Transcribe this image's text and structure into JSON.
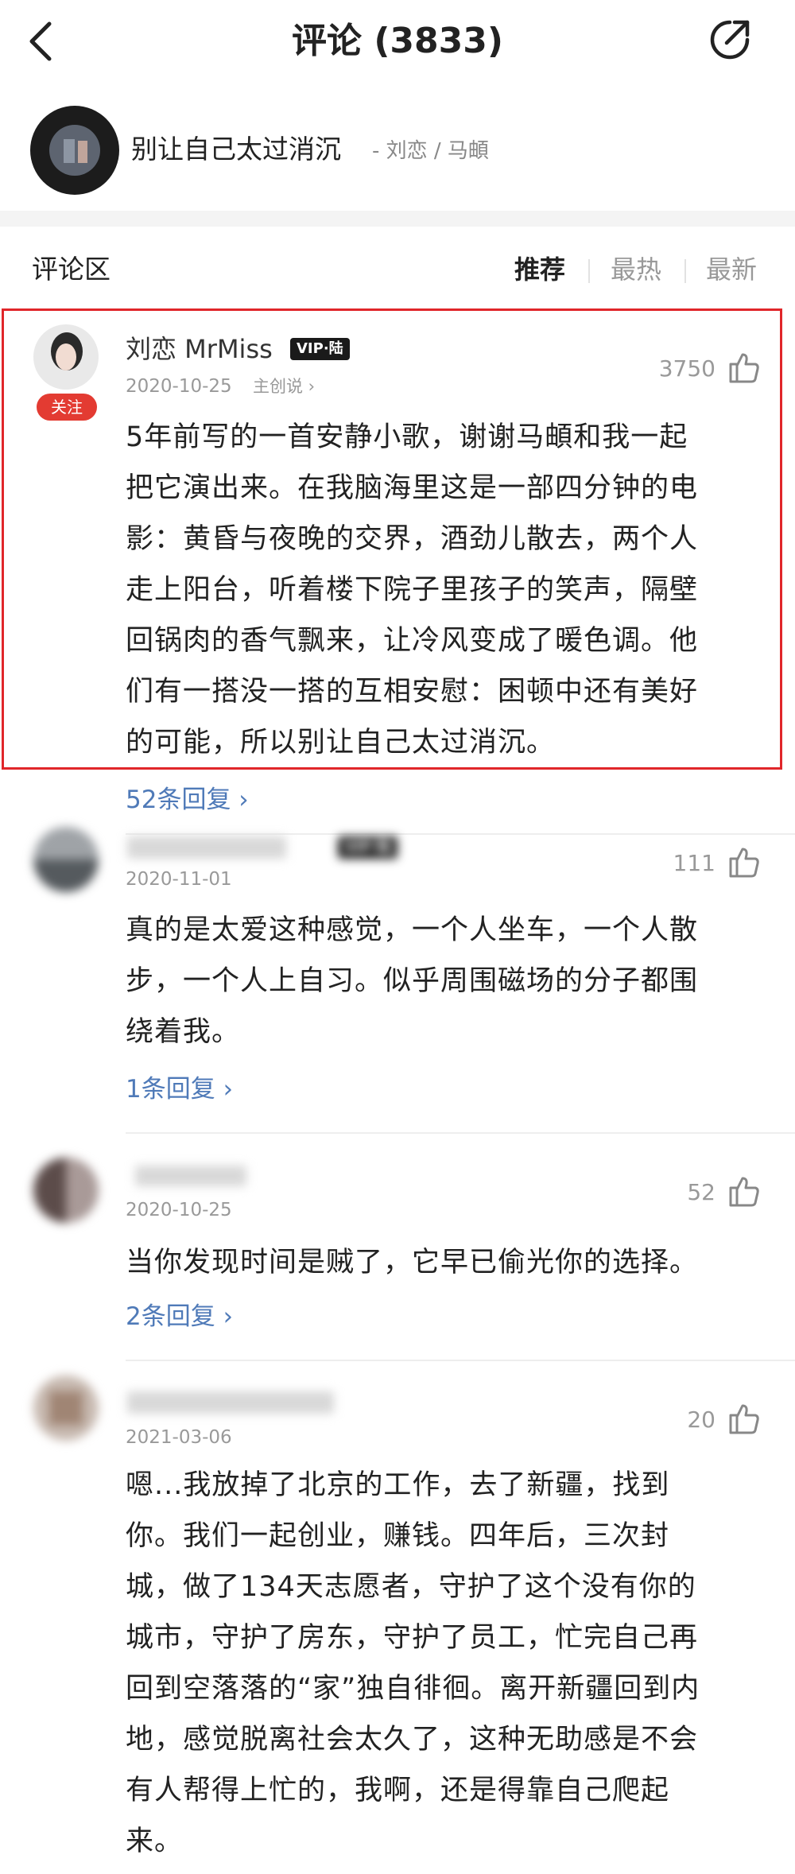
{
  "header": {
    "title": "评论 (3833)"
  },
  "song": {
    "title": "别让自己太过消沉",
    "artists": "- 刘恋 / 马頔"
  },
  "section": {
    "title": "评论区",
    "tabs": [
      {
        "label": "推荐",
        "active": true
      },
      {
        "label": "最热",
        "active": false
      },
      {
        "label": "最新",
        "active": false
      }
    ]
  },
  "comments": [
    {
      "username": "刘恋 MrMiss",
      "vip": "VIP·陆",
      "date": "2020-10-25",
      "author_tag": "主创说 ›",
      "follow": "关注",
      "likes": "3750",
      "lines": [
        "5年前写的一首安静小歌，谢谢马頔和我一起",
        "把它演出来。在我脑海里这是一部四分钟的电",
        "影：黄昏与夜晚的交界，酒劲儿散去，两个人",
        "走上阳台，听着楼下院子里孩子的笑声，隔壁",
        "回锅肉的香气飘来，让冷风变成了暖色调。他",
        "们有一搭没一搭的互相安慰：困顿中还有美好",
        "的可能，所以别让自己太过消沉。"
      ],
      "replies": "52条回复 ›"
    },
    {
      "username": "",
      "vip": "VIP·陆",
      "date": "2020-11-01",
      "likes": "111",
      "lines": [
        "真的是太爱这种感觉，一个人坐车，一个人散",
        "步，一个人上自习。似乎周围磁场的分子都围",
        "绕着我。"
      ],
      "replies": "1条回复 ›"
    },
    {
      "username": "",
      "date": "2020-10-25",
      "likes": "52",
      "lines": [
        "当你发现时间是贼了，它早已偷光你的选择。"
      ],
      "replies": "2条回复 ›"
    },
    {
      "username": "",
      "date": "2021-03-06",
      "likes": "20",
      "lines": [
        "嗯...我放掉了北京的工作，去了新疆，找到",
        "你。我们一起创业，赚钱。四年后，三次封",
        "城，做了134天志愿者，守护了这个没有你的",
        "城市，守护了房东，守护了员工，忙完自己再",
        "回到空落落的“家”独自徘徊。离开新疆回到内",
        "地，感觉脱离社会太久了，这种无助感是不会",
        "有人帮得上忙的，我啊，还是得靠自己爬起",
        "来。"
      ]
    }
  ],
  "icons": {
    "back": "chevron-left-icon",
    "share": "share-icon",
    "like": "thumbs-up-icon"
  },
  "colors": {
    "highlight": "#e0262a",
    "follow_badge": "#e33b32",
    "reply_link": "#4f7ab8"
  }
}
